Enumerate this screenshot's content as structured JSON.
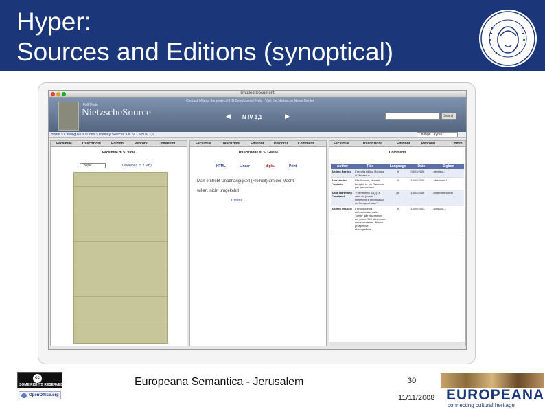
{
  "slide": {
    "title_line1": "Hyper:",
    "title_line2": "Sources and Editions (synoptical)",
    "footer": "Europeana Semantica - Jerusalem",
    "page_number": "30",
    "date": "11/11/2008"
  },
  "logos": {
    "cc_label": "SOME RIGHTS RESERVED",
    "cc_symbol": "cc",
    "openoffice_label": "OpenOffice.org",
    "europeana_name": "EUROPEANA",
    "europeana_tagline": "connecting cultural heritage"
  },
  "browser": {
    "window_title": "Untitled Document",
    "top_links": "Contact | About the project | HN Developers | Help | Visit the Nietzsche News Center",
    "full_mode": "Full Mode",
    "brand": "NietzscheSource",
    "signum": "N IV 1,1",
    "prev_icon": "◀",
    "next_icon": "▶",
    "search_button": "Search",
    "breadcrumb": "Home > Catalogues > D'Iorio > Primary Sources > N IV 1 > N IV 1,1",
    "layout_select": "Change Layout"
  },
  "panel_left": {
    "tabs": [
      "Facsimile",
      "Trascrizioni",
      "Edizioni",
      "Percorsi",
      "Commenti"
    ],
    "title": "Facsimile di S. Viola",
    "select": "Loupe",
    "download": "Download (5.2 MB)"
  },
  "panel_middle": {
    "tabs": [
      "Facsimile",
      "Trascrizioni",
      "Edizioni",
      "Percorsi",
      "Commenti"
    ],
    "title": "Trascrizione di S. Gerike",
    "formats": [
      "HTML",
      "Linear",
      "diplo.",
      "Print"
    ],
    "line1": "Man erstrebt Unabhängigkeit (Freiheit) um der Macht",
    "line2": "willen, nicht umgekehrt",
    "criteria": "Criteria..."
  },
  "panel_right": {
    "tabs": [
      "Facsimile",
      "Trascrizioni",
      "Edizioni",
      "Percorsi",
      "Comm"
    ],
    "title": "Commenti",
    "columns": [
      "Author",
      "Title",
      "Language",
      "Date",
      "Siglum"
    ],
    "rows": [
      {
        "author": "Andrea Bertino",
        "title": "L'eredità idillica Rohana di Nietzsche",
        "language": "it",
        "date": "03/03/2006",
        "siglum": "abertino-1"
      },
      {
        "author": "Alessandro Farabrini",
        "title": "Elle Illusioni, diverse, Langbehn: Un Racconto per precorritrice",
        "language": "it",
        "date": "15/09/2006",
        "siglum": "afarabrini-1"
      },
      {
        "author": "Anna Hartmann Cavalcanti",
        "title": "\"Frammento 12(1): a crise do jovem Nietzsche e inscificação de Schopenhauer\"",
        "language": "po",
        "date": "14/04/2006",
        "siglum": "ahartmanncaval"
      },
      {
        "author": "Andrea Orsucci",
        "title": "L'enciclopedia nietzscheana dalle 'scritte' alle discussioni del primo '900 attraverso corrispondenze. Nuove prospettive storiografiche",
        "language": "it",
        "date": "13/09/2003",
        "siglum": "aorsucci-1"
      }
    ]
  }
}
